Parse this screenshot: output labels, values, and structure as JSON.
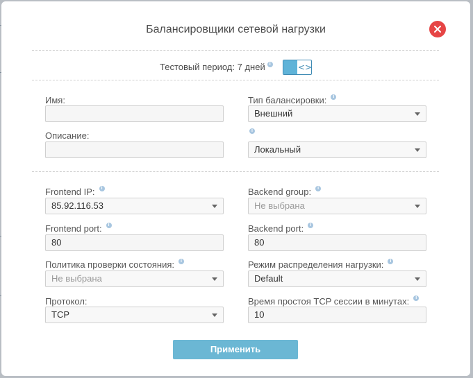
{
  "dialog": {
    "title": "Балансировщики сетевой нагрузки",
    "trial_label": "Тестовый период: 7 дней",
    "apply_label": "Применить"
  },
  "form": {
    "name_label": "Имя:",
    "name_value": "",
    "description_label": "Описание:",
    "description_value": "",
    "balancing_type_label": "Тип балансировки:",
    "balancing_type_value": "Внешний",
    "scope_value": "Локальный",
    "frontend_ip_label": "Frontend IP:",
    "frontend_ip_value": "85.92.116.53",
    "backend_group_label": "Backend group:",
    "backend_group_value": "Не выбрана",
    "frontend_port_label": "Frontend port:",
    "frontend_port_value": "80",
    "backend_port_label": "Backend port:",
    "backend_port_value": "80",
    "health_policy_label": "Политика проверки состояния:",
    "health_policy_value": "Не выбрана",
    "distribution_mode_label": "Режим распределения нагрузки:",
    "distribution_mode_value": "Default",
    "protocol_label": "Протокол:",
    "protocol_value": "TCP",
    "idle_timeout_label": "Время простоя TCP сессии в минутах:",
    "idle_timeout_value": "10"
  },
  "icons": {
    "info": "i",
    "toggle_arrows": "<>"
  },
  "colors": {
    "close": "#e64545",
    "accent": "#6bb7d4",
    "info": "#a8c6e0"
  }
}
